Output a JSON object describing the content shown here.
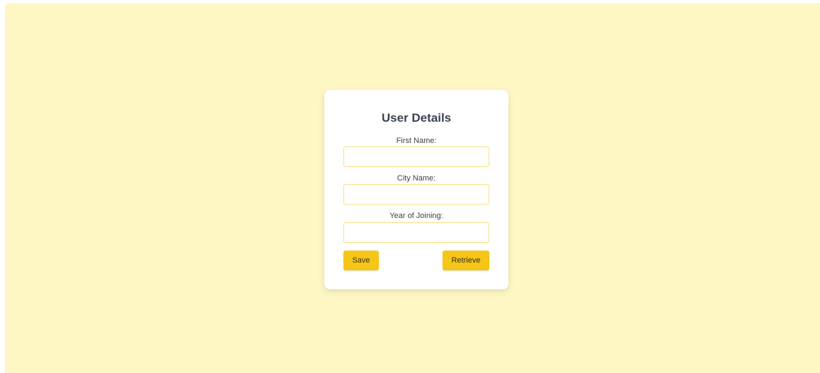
{
  "form": {
    "title": "User Details",
    "fields": [
      {
        "label": "First Name:",
        "value": "",
        "placeholder": ""
      },
      {
        "label": "City Name:",
        "value": "",
        "placeholder": ""
      },
      {
        "label": "Year of Joining:",
        "value": "",
        "placeholder": ""
      }
    ],
    "buttons": {
      "save_label": "Save",
      "retrieve_label": "Retrieve"
    }
  },
  "colors": {
    "background": "#fef7c3",
    "card": "#ffffff",
    "button": "#f5c518",
    "input_border": "#f8df7a",
    "title_text": "#3b4252"
  }
}
